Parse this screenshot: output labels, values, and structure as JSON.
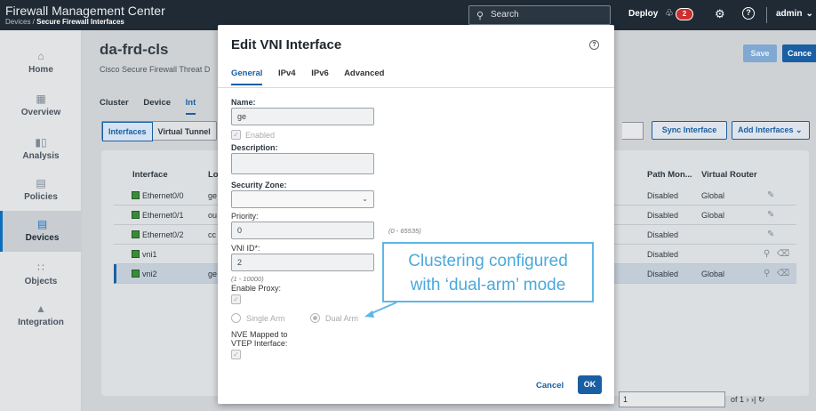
{
  "header": {
    "app_title": "Firewall Management Center",
    "breadcrumb_prefix": "Devices / ",
    "breadcrumb_current": "Secure Firewall Interfaces",
    "search_placeholder": "Search",
    "deploy_label": "Deploy",
    "notification_count": "2",
    "user_label": "admin"
  },
  "sidebar": {
    "items": [
      {
        "label": "Home",
        "icon": "home-icon"
      },
      {
        "label": "Overview",
        "icon": "overview-icon"
      },
      {
        "label": "Analysis",
        "icon": "analysis-icon"
      },
      {
        "label": "Policies",
        "icon": "policies-icon"
      },
      {
        "label": "Devices",
        "icon": "devices-icon",
        "active": true
      },
      {
        "label": "Objects",
        "icon": "objects-icon"
      },
      {
        "label": "Integration",
        "icon": "integration-icon"
      }
    ]
  },
  "page": {
    "device_name": "da-frd-cls",
    "device_subtitle": "Cisco Secure Firewall Threat D",
    "save_label": "Save",
    "cancel_label": "Cance",
    "tabs": [
      "Cluster",
      "Device",
      "Int"
    ],
    "subtabs": [
      "Interfaces",
      "Virtual Tunnel"
    ],
    "sync_label": "Sync Interface",
    "add_label": "Add Interfaces"
  },
  "table": {
    "headers": {
      "interface": "Interface",
      "lo": "Lo",
      "path": "Path Mon...",
      "vrouter": "Virtual Router"
    },
    "rows": [
      {
        "interface": "Ethernet0/0",
        "lo": "ge",
        "path": "Disabled",
        "vrouter": "Global"
      },
      {
        "interface": "Ethernet0/1",
        "lo": "ou",
        "path": "Disabled",
        "vrouter": "Global"
      },
      {
        "interface": "Ethernet0/2",
        "lo": "cc",
        "path": "Disabled",
        "vrouter": ""
      },
      {
        "interface": "vni1",
        "lo": "",
        "path": "Disabled",
        "vrouter": ""
      },
      {
        "interface": "vni2",
        "lo": "ge",
        "path": "Disabled",
        "vrouter": "Global"
      }
    ],
    "pager_value": "1",
    "pager_text": "of 1"
  },
  "modal": {
    "title": "Edit VNI Interface",
    "tabs": [
      "General",
      "IPv4",
      "IPv6",
      "Advanced"
    ],
    "name_label": "Name:",
    "name_value": "ge",
    "enabled_label": "Enabled",
    "description_label": "Description:",
    "description_value": "",
    "security_zone_label": "Security Zone:",
    "security_zone_value": "",
    "priority_label": "Priority:",
    "priority_value": "0",
    "priority_hint": "(0 - 65535)",
    "vni_label": "VNI ID*:",
    "vni_value": "2",
    "vni_hint": "(1 - 10000)",
    "enable_proxy_label": "Enable Proxy:",
    "single_arm_label": "Single Arm",
    "dual_arm_label": "Dual Arm",
    "nve_label_line1": "NVE Mapped to",
    "nve_label_line2": "VTEP Interface:",
    "cancel_label": "Cancel",
    "ok_label": "OK"
  },
  "callout": {
    "line1": "Clustering configured",
    "line2": "with ‘dual-arm’ mode"
  },
  "colors": {
    "topbar": "#1f2a35",
    "accent": "#1a5fa3",
    "callout": "#4aa9dd",
    "badge": "#cf2e2e"
  }
}
